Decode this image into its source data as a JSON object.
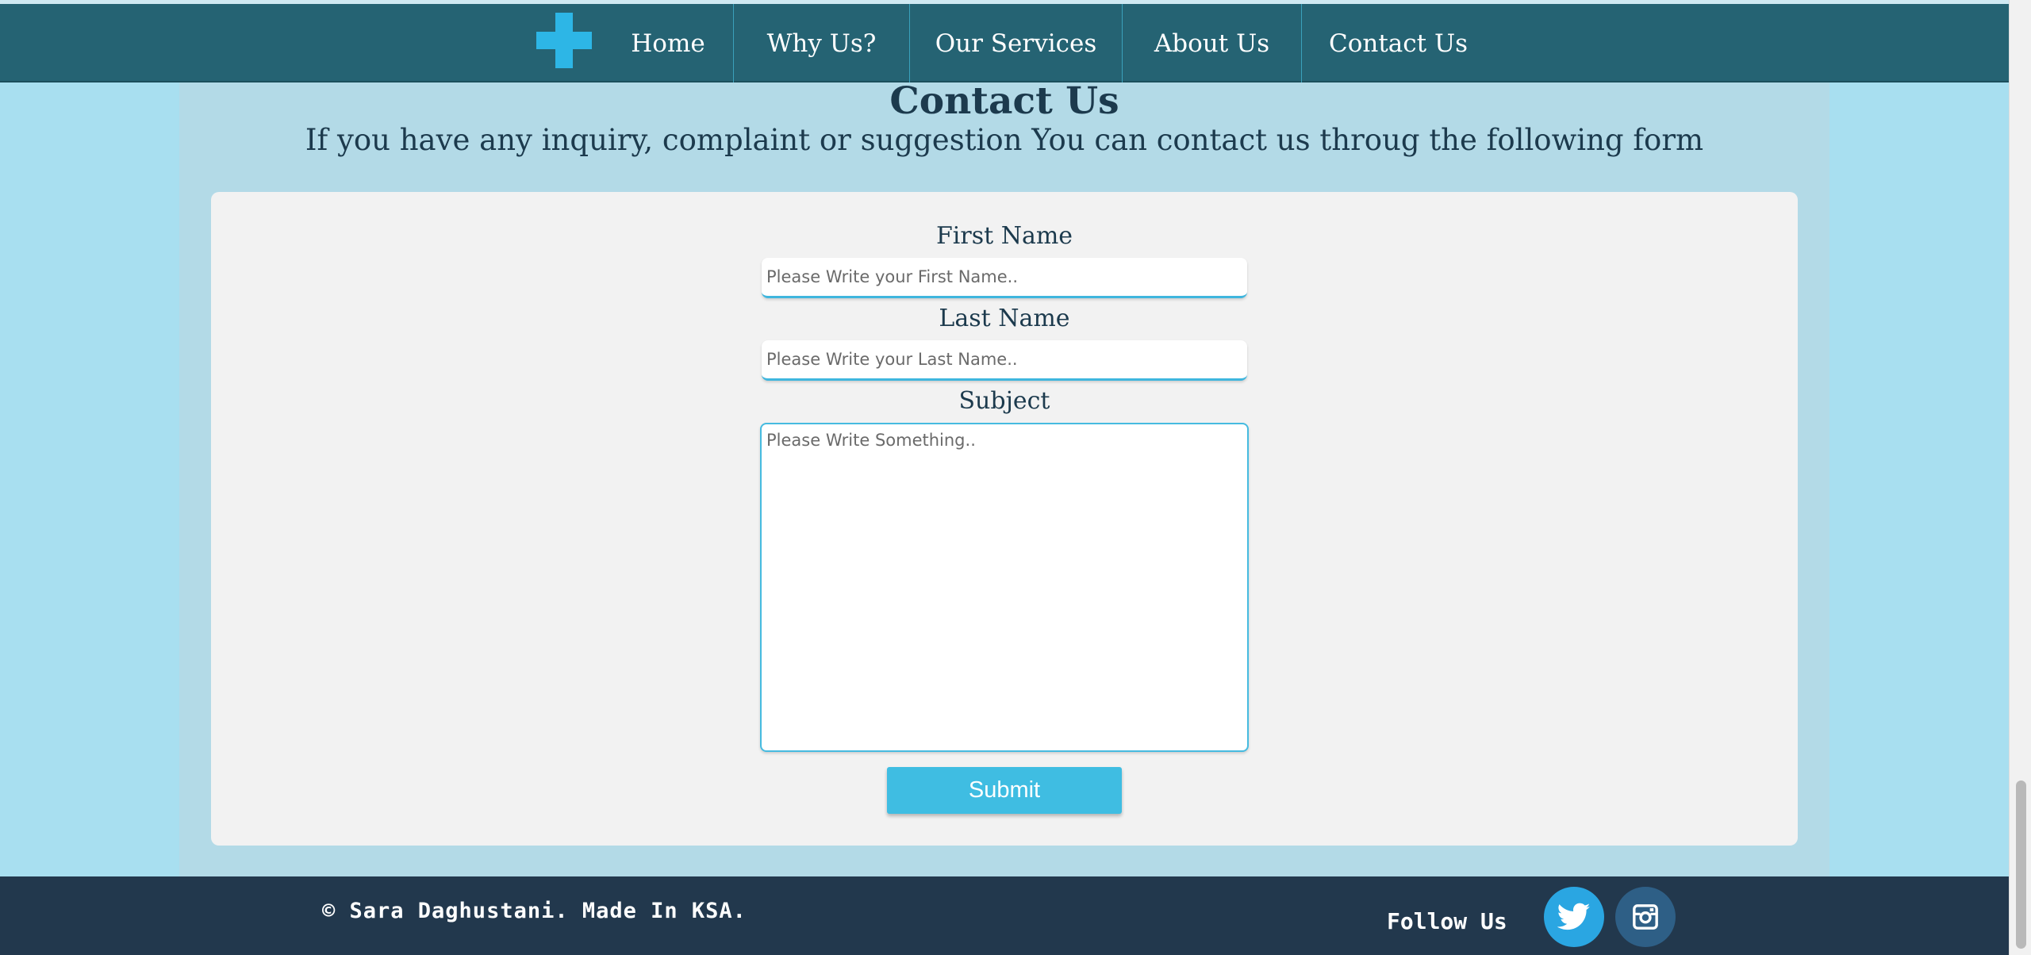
{
  "nav": {
    "items": [
      "Home",
      "Why Us?",
      "Our Services",
      "About Us",
      "Contact Us"
    ]
  },
  "page": {
    "title": "Contact Us",
    "subtitle": "If you have any inquiry, complaint or suggestion You can contact us throug the following form"
  },
  "form": {
    "first_name_label": "First Name",
    "first_name_placeholder": "Please Write your First Name..",
    "first_name_value": "",
    "last_name_label": "Last Name",
    "last_name_placeholder": "Please Write your Last Name..",
    "last_name_value": "",
    "subject_label": "Subject",
    "subject_placeholder": "Please Write Something..",
    "subject_value": "",
    "submit_label": "Submit"
  },
  "footer": {
    "copyright": "© Sara Daghustani. Made In KSA.",
    "follow_label": "Follow Us",
    "social": [
      "twitter-icon",
      "instagram-icon"
    ]
  },
  "colors": {
    "nav_bg": "#256373",
    "accent": "#3fbde2",
    "panel_bg": "#b3dae7",
    "page_bg": "#a8dff0",
    "footer_bg": "#22384d",
    "text": "#1c3a4d"
  }
}
